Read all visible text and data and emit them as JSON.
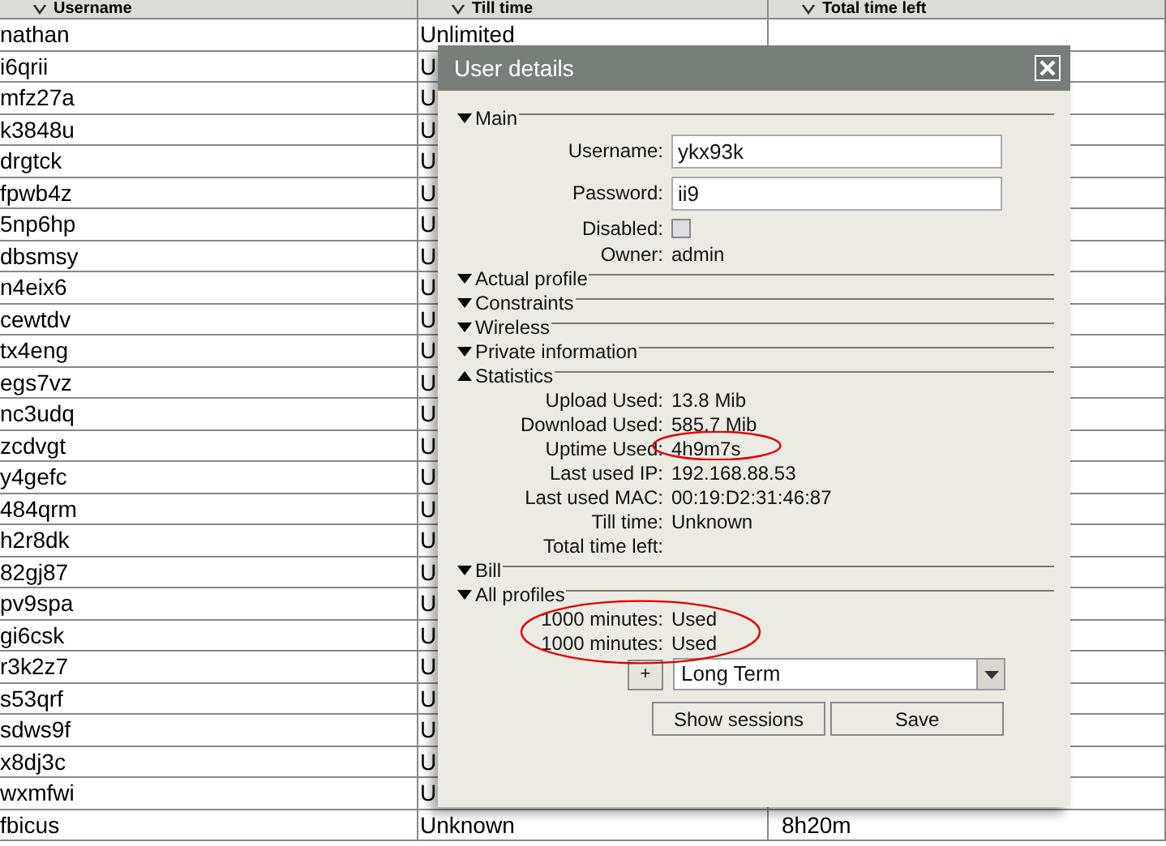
{
  "table": {
    "columns": [
      {
        "label": "Username"
      },
      {
        "label": "Till time"
      },
      {
        "label": "Total time left"
      }
    ],
    "rows": [
      {
        "username": "nathan",
        "till_time": "Unlimited"
      },
      {
        "username": "i6qrii",
        "till_time": "U"
      },
      {
        "username": "mfz27a",
        "till_time": "U"
      },
      {
        "username": "k3848u",
        "till_time": "U"
      },
      {
        "username": "drgtck",
        "till_time": "U"
      },
      {
        "username": "fpwb4z",
        "till_time": "U"
      },
      {
        "username": "5np6hp",
        "till_time": "U"
      },
      {
        "username": "dbsmsy",
        "till_time": "U"
      },
      {
        "username": "n4eix6",
        "till_time": "U"
      },
      {
        "username": "cewtdv",
        "till_time": "U"
      },
      {
        "username": "tx4eng",
        "till_time": "U"
      },
      {
        "username": "egs7vz",
        "till_time": "U"
      },
      {
        "username": "nc3udq",
        "till_time": "U"
      },
      {
        "username": "zcdvgt",
        "till_time": "U"
      },
      {
        "username": "y4gefc",
        "till_time": "U"
      },
      {
        "username": "484qrm",
        "till_time": "U"
      },
      {
        "username": "h2r8dk",
        "till_time": "U"
      },
      {
        "username": "82gj87",
        "till_time": "U"
      },
      {
        "username": "pv9spa",
        "till_time": "U"
      },
      {
        "username": "gi6csk",
        "till_time": "U"
      },
      {
        "username": "r3k2z7",
        "till_time": "U"
      },
      {
        "username": "s53qrf",
        "till_time": "U"
      },
      {
        "username": "sdws9f",
        "till_time": "U"
      },
      {
        "username": "x8dj3c",
        "till_time": "U"
      },
      {
        "username": "wxmfwi",
        "till_time": "U"
      },
      {
        "username": "fbicus",
        "till_time": "Unknown",
        "total_time_left": "8h20m"
      }
    ]
  },
  "dialog": {
    "title": "User details",
    "sections": [
      {
        "title": "Main",
        "arrow_up": false,
        "fields": [
          {
            "kind": "input",
            "label": "Username:",
            "value": "ykx93k"
          },
          {
            "kind": "input",
            "label": "Password:",
            "value": "ii9"
          },
          {
            "kind": "checkbox",
            "label": "Disabled:",
            "checked": false
          },
          {
            "kind": "text",
            "label": "Owner:",
            "value": "admin"
          }
        ]
      },
      {
        "title": "Actual profile",
        "arrow_up": false
      },
      {
        "title": "Constraints",
        "arrow_up": false
      },
      {
        "title": "Wireless",
        "arrow_up": false
      },
      {
        "title": "Private information",
        "arrow_up": false
      },
      {
        "title": "Statistics",
        "arrow_up": true,
        "fields": [
          {
            "kind": "text",
            "label": "Upload Used:",
            "value": "13.8 Mib"
          },
          {
            "kind": "text",
            "label": "Download Used:",
            "value": "585.7 Mib"
          },
          {
            "kind": "text",
            "label": "Uptime Used:",
            "value": "4h9m7s",
            "circled": true
          },
          {
            "kind": "text",
            "label": "Last used IP:",
            "value": "192.168.88.53"
          },
          {
            "kind": "text",
            "label": "Last used MAC:",
            "value": "00:19:D2:31:46:87"
          },
          {
            "kind": "text",
            "label": "Till time:",
            "value": "Unknown"
          },
          {
            "kind": "text",
            "label": "Total time left:"
          }
        ]
      },
      {
        "title": "Bill",
        "arrow_up": false
      },
      {
        "title": "All profiles",
        "arrow_up": false,
        "circled": true,
        "fields": [
          {
            "kind": "text",
            "label": "1000 minutes:",
            "value": "Used"
          },
          {
            "kind": "text",
            "label": "1000 minutes:",
            "value": "Used"
          }
        ]
      }
    ],
    "add_button": "+",
    "profile_select": {
      "value": "Long Term"
    },
    "buttons": [
      "Show sessions",
      "Save"
    ]
  }
}
